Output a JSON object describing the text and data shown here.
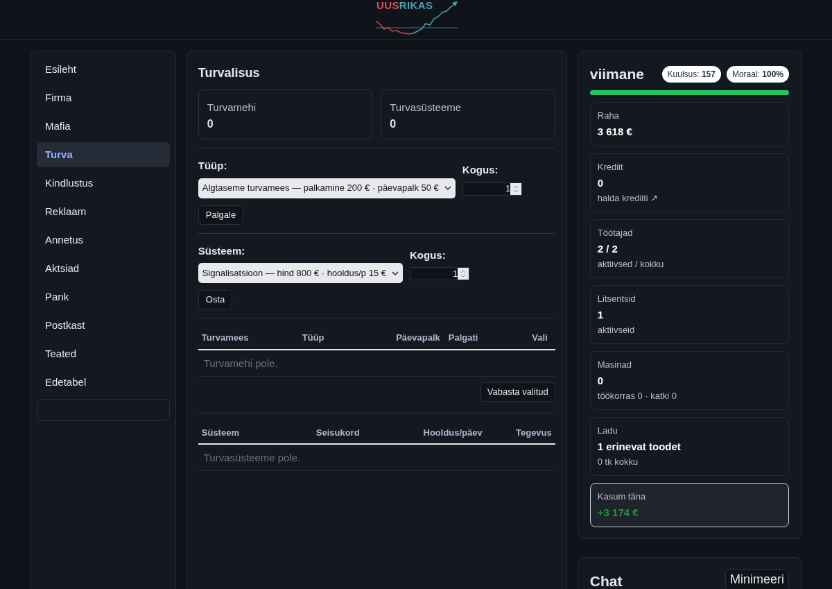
{
  "logo": {
    "part_1": "UUS",
    "part_2": "RIKAS"
  },
  "sidebar": {
    "items": [
      {
        "label": "Esileht",
        "selected": false
      },
      {
        "label": "Firma",
        "selected": false
      },
      {
        "label": "Mafia",
        "selected": false
      },
      {
        "label": "Turva",
        "selected": true
      },
      {
        "label": "Kindlustus",
        "selected": false
      },
      {
        "label": "Reklaam",
        "selected": false
      },
      {
        "label": "Annetus",
        "selected": false
      },
      {
        "label": "Aktsiad",
        "selected": false
      },
      {
        "label": "Pank",
        "selected": false
      },
      {
        "label": "Postkast",
        "selected": false
      },
      {
        "label": "Teated",
        "selected": false
      },
      {
        "label": "Edetabel",
        "selected": false
      }
    ]
  },
  "main": {
    "title": "Turvalisus",
    "stats": [
      {
        "label": "Turvamehi",
        "value": "0"
      },
      {
        "label": "Turvasüsteeme",
        "value": "0"
      }
    ],
    "forms": [
      {
        "label": "Tüüp:",
        "select": "Algtaseme turvamees — palkamine 200 € · päevapalk 50 €",
        "qty_label": "Kogus:",
        "qty": "1",
        "button": "Palgale"
      },
      {
        "label": "Süsteem:",
        "select": "Signalisatsioon — hind 800 € · hooldus/p 15 €",
        "qty_label": "Kogus:",
        "qty": "1",
        "button": "Osta"
      }
    ],
    "guards_table": {
      "columns": [
        "Turvamees",
        "Tüüp",
        "Päevapalk",
        "Palgati",
        "Vali"
      ],
      "empty": "Turvamehi pole.",
      "button": "Vabasta valitud"
    },
    "systems_table": {
      "columns": [
        "Süsteem",
        "Seisukord",
        "Hooldus/päev",
        "Tegevus"
      ],
      "empty": "Turvasüsteeme pole."
    }
  },
  "profile": {
    "name": "viimane",
    "badges": [
      {
        "label": "Kuulsus:",
        "value": "157"
      },
      {
        "label": "Moraal:",
        "value": "100%"
      }
    ],
    "morale": {
      "level": 1
    },
    "cards": [
      {
        "label": "Raha",
        "value": "3 618 €",
        "highlighted": false,
        "positive": false
      },
      {
        "label": "Krediit",
        "value": "0",
        "link": "halda krediiti ↗",
        "highlighted": false,
        "positive": false
      },
      {
        "label": "Töötajad",
        "value": "2 / 2",
        "note": "aktiivsed / kokku",
        "highlighted": false,
        "positive": false
      },
      {
        "label": "Litsentsid",
        "value": "1",
        "note": "aktiivseid",
        "highlighted": false,
        "positive": false
      },
      {
        "label": "Masinad",
        "value": "0",
        "note": "töökorras 0 · katki 0",
        "highlighted": false,
        "positive": false
      },
      {
        "label": "Ladu",
        "value": "1 erinevat toodet",
        "note": "0 tk kokku",
        "highlighted": false,
        "positive": false
      },
      {
        "label": "Kasum täna",
        "value": "+3 174 €",
        "highlighted": true,
        "positive": true
      }
    ]
  },
  "chat": {
    "title": "Chat",
    "button": "Minimeeri"
  }
}
